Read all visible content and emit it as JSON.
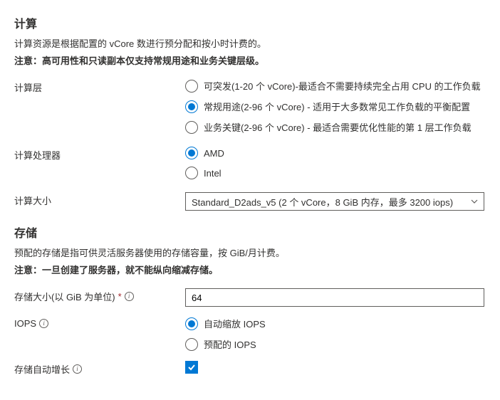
{
  "compute": {
    "title": "计算",
    "desc": "计算资源是根据配置的 vCore 数进行预分配和按小时计费的。",
    "note_label": "注意：",
    "note_text": "高可用性和只读副本仅支持常规用途和业务关键层级。",
    "tier_label": "计算层",
    "tier_options": {
      "burstable": "可突发(1-20 个 vCore)-最适合不需要持续完全占用 CPU 的工作负载",
      "general": "常规用途(2-96 个 vCore) - 适用于大多数常见工作负载的平衡配置",
      "business": "业务关键(2-96 个 vCore) - 最适合需要优化性能的第 1 层工作负载"
    },
    "processor_label": "计算处理器",
    "processor_options": {
      "amd": "AMD",
      "intel": "Intel"
    },
    "size_label": "计算大小",
    "size_value": "Standard_D2ads_v5 (2 个 vCore，8 GiB 内存，最多 3200 iops)"
  },
  "storage": {
    "title": "存储",
    "desc": "预配的存储是指可供灵活服务器使用的存储容量，按 GiB/月计费。",
    "note_label": "注意：",
    "note_text": "一旦创建了服务器，就不能纵向缩减存储。",
    "size_label": "存储大小(以 GiB 为单位)",
    "size_value": "64",
    "iops_label": "IOPS",
    "iops_options": {
      "auto": "自动缩放 IOPS",
      "provisioned": "预配的 IOPS"
    },
    "autogrow_label": "存储自动增长"
  }
}
